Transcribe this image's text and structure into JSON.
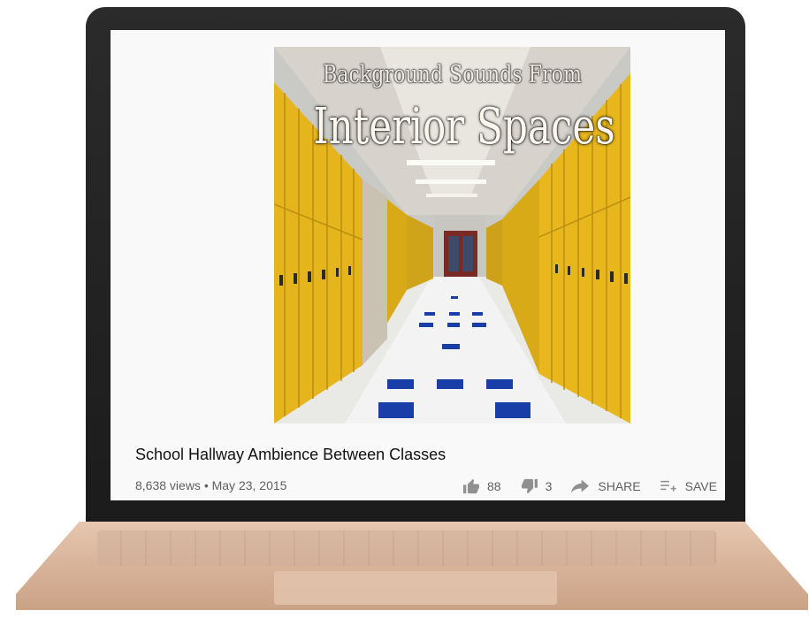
{
  "artwork": {
    "line1": "Background Sounds From",
    "line2": "Interior Spaces"
  },
  "video": {
    "title": "School Hallway Ambience Between Classes",
    "meta": "8,638 views • May 23, 2015"
  },
  "actions": {
    "likes": "88",
    "dislikes": "3",
    "share": "SHARE",
    "save": "SAVE"
  },
  "colors": {
    "locker": "#e9b61f",
    "text_secondary": "#606060"
  },
  "icons": [
    "thumbs-up-icon",
    "thumbs-down-icon",
    "share-arrow-icon",
    "playlist-add-icon"
  ]
}
